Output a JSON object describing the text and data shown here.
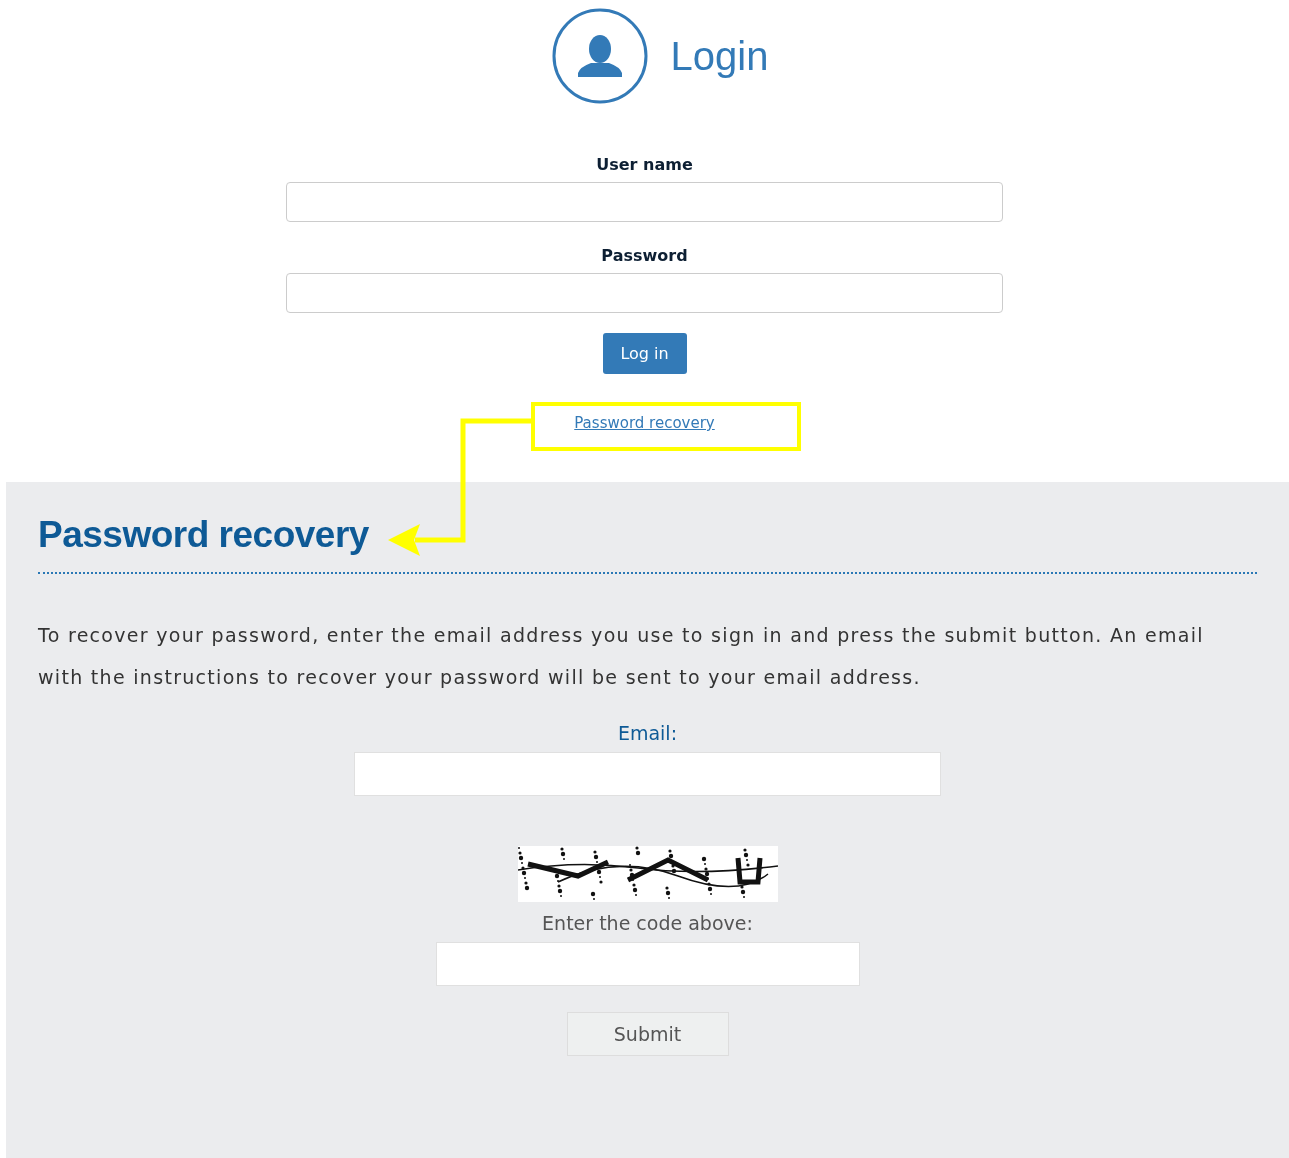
{
  "login": {
    "title": "Login",
    "fields": [
      {
        "label": "User name"
      },
      {
        "label": "Password"
      }
    ],
    "button": "Log in",
    "recovery_link": "Password recovery"
  },
  "recovery": {
    "title": "Password recovery",
    "instructions": "To recover your password, enter the email address you use to sign in and press the submit button. An email with the instructions to recover your password will be sent to your email address.",
    "email_label": "Email:",
    "code_label": "Enter the code above:",
    "submit": "Submit"
  }
}
